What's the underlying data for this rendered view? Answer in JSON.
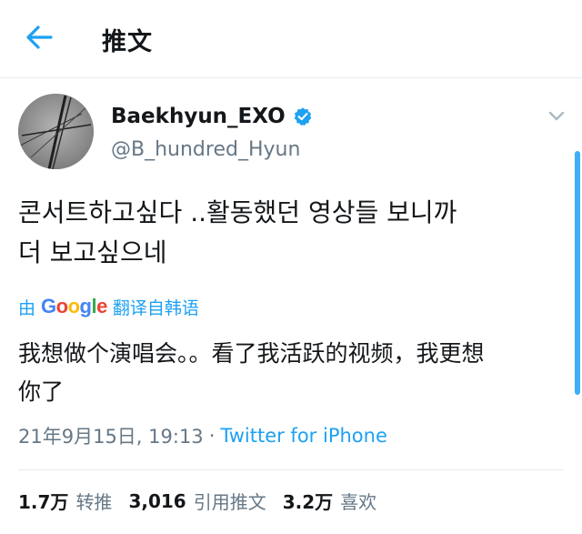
{
  "header": {
    "title": "推文"
  },
  "tweet": {
    "display_name": "Baekhyun_EXO",
    "handle": "@B_hundred_Hyun",
    "text_lines": [
      "콘서트하고싶다 ..활동했던 영상들 보니까",
      "더 보고싶으네"
    ],
    "translate": {
      "by": "由",
      "google": "Google",
      "suffix": "翻译自韩语"
    },
    "translated_lines": [
      "我想做个演唱会。。看了我活跃的视频，我更想",
      "你了"
    ],
    "timestamp": "21年9月15日, 19:13",
    "separator": "·",
    "source": "Twitter for iPhone"
  },
  "stats": {
    "retweets": {
      "num": "1.7万",
      "label": "转推"
    },
    "quotes": {
      "num": "3,016",
      "label": "引用推文"
    },
    "likes": {
      "num": "3.2万",
      "label": "喜欢"
    }
  },
  "colors": {
    "accent": "#1da1f2",
    "text": "#14171a",
    "muted": "#657786",
    "divider": "#e6ecf0"
  },
  "icons": {
    "back": "back-arrow-icon",
    "verified": "verified-badge-icon",
    "more": "chevron-down-icon"
  }
}
